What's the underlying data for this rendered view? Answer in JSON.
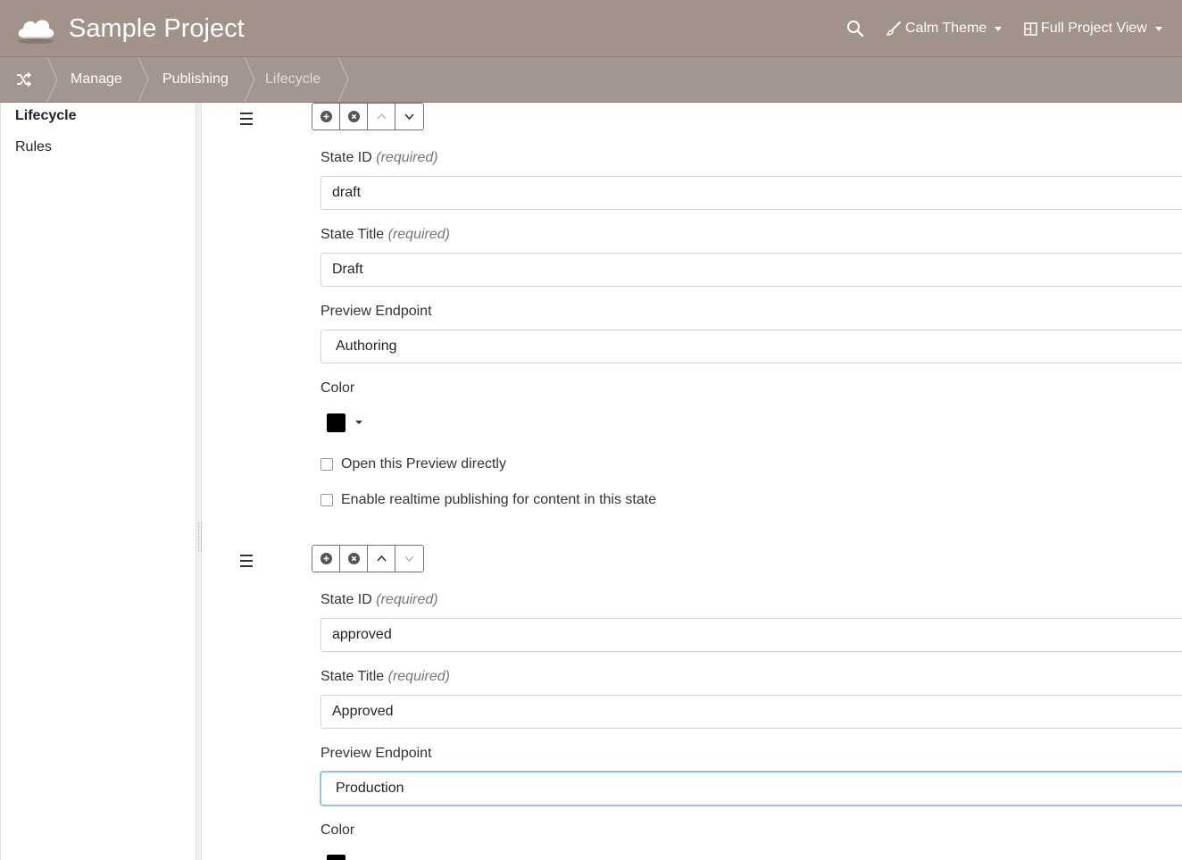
{
  "header": {
    "app_title": "Sample Project",
    "logo_icon": "cloud-logo-icon",
    "search_icon": "search-icon",
    "theme_menu": {
      "icon": "brush-icon",
      "label": "Calm Theme"
    },
    "view_menu": {
      "icon": "layout-icon",
      "label": "Full Project View"
    }
  },
  "breadcrumb": {
    "home_icon": "shuffle-icon",
    "items": [
      "Manage",
      "Publishing",
      "Lifecycle"
    ]
  },
  "sidebar": {
    "items": [
      {
        "label": "Lifecycle",
        "active": true
      },
      {
        "label": "Rules",
        "active": false
      }
    ]
  },
  "states": [
    {
      "state_id_label": "State ID",
      "state_id_hint": "(required)",
      "state_id_value": "draft",
      "state_title_label": "State Title",
      "state_title_hint": "(required)",
      "state_title_value": "Draft",
      "preview_endpoint_label": "Preview Endpoint",
      "preview_endpoint_value": "Authoring",
      "color_label": "Color",
      "color_value": "#000000",
      "open_preview_label": "Open this Preview directly",
      "open_preview_checked": false,
      "realtime_label": "Enable realtime publishing for content in this state",
      "realtime_checked": false
    },
    {
      "state_id_label": "State ID",
      "state_id_hint": "(required)",
      "state_id_value": "approved",
      "state_title_label": "State Title",
      "state_title_hint": "(required)",
      "state_title_value": "Approved",
      "preview_endpoint_label": "Preview Endpoint",
      "preview_endpoint_value": "Production",
      "color_label": "Color",
      "color_value": "#000000"
    }
  ],
  "colors": {
    "header_bg": "#a1928a",
    "breadcrumb_bg": "#a39690",
    "focus_border": "#80bdff"
  }
}
